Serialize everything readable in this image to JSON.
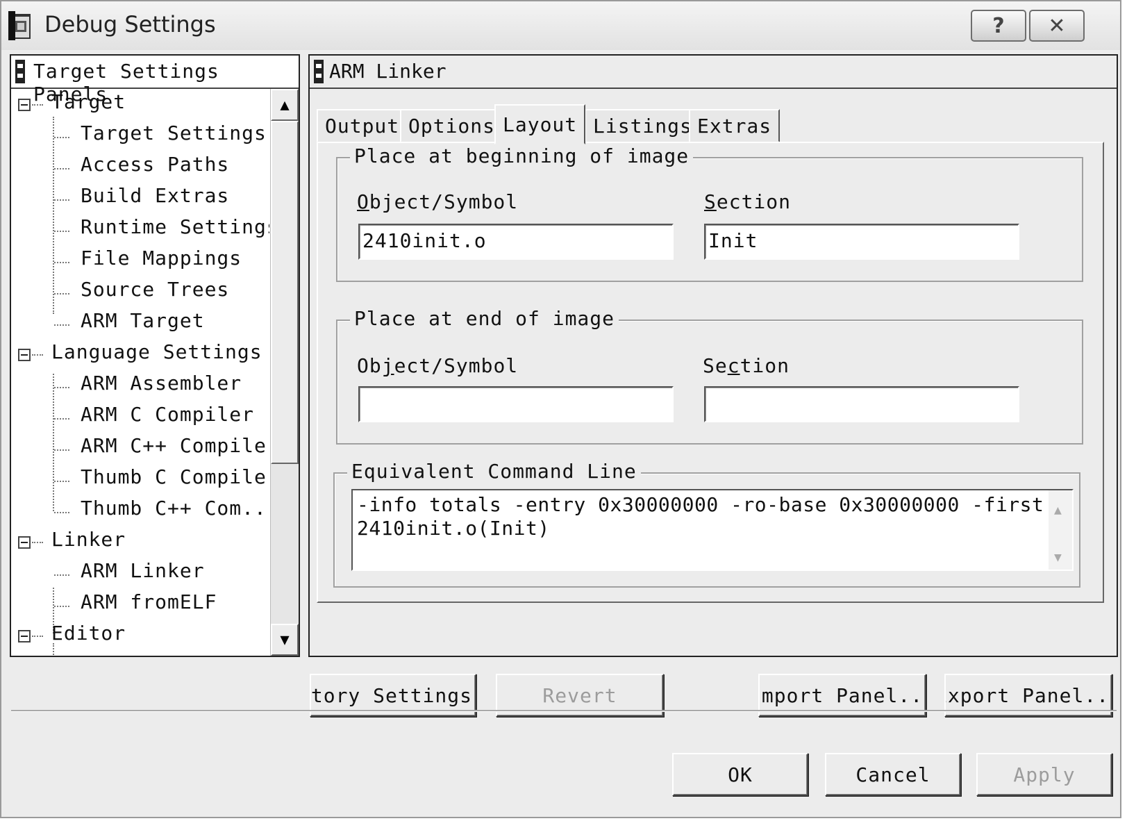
{
  "window": {
    "title": "Debug Settings",
    "help_button": "?",
    "close_button": "✕"
  },
  "left_panel": {
    "header": "Target Settings Panels",
    "tree": [
      {
        "label": "Target",
        "level": 0,
        "expander": true
      },
      {
        "label": "Target Settings",
        "level": 1
      },
      {
        "label": "Access Paths",
        "level": 1
      },
      {
        "label": "Build Extras",
        "level": 1
      },
      {
        "label": "Runtime Settings",
        "level": 1
      },
      {
        "label": "File Mappings",
        "level": 1
      },
      {
        "label": "Source Trees",
        "level": 1
      },
      {
        "label": "ARM Target",
        "level": 1
      },
      {
        "label": "Language Settings",
        "level": 0,
        "expander": true
      },
      {
        "label": "ARM Assembler",
        "level": 1
      },
      {
        "label": "ARM C Compiler",
        "level": 1
      },
      {
        "label": "ARM C++ Compiler",
        "level": 1
      },
      {
        "label": "Thumb C Compiler",
        "level": 1
      },
      {
        "label": "Thumb C++ Com...",
        "level": 1
      },
      {
        "label": "Linker",
        "level": 0,
        "expander": true
      },
      {
        "label": "ARM Linker",
        "level": 1
      },
      {
        "label": "ARM fromELF",
        "level": 1
      },
      {
        "label": "Editor",
        "level": 0,
        "expander": true
      }
    ],
    "scroll_up": "▲",
    "scroll_down": "▼"
  },
  "right_panel": {
    "header": "ARM Linker",
    "tabs": [
      "Output",
      "Options",
      "Layout",
      "Listings",
      "Extras"
    ],
    "active_tab": "Layout",
    "beginning_group": {
      "legend": "Place at beginning of image",
      "object_label_first": "O",
      "object_label_rest": "bject/Symbol",
      "section_label_first": "S",
      "section_label_rest": "ection",
      "object_value": "2410init.o",
      "section_value": "Init"
    },
    "end_group": {
      "legend": "Place at end of image",
      "object_label_pre": "Ob",
      "object_label_u": "j",
      "object_label_post": "ect/Symbol",
      "section_label_pre": "Se",
      "section_label_u": "c",
      "section_label_post": "tion",
      "object_value": "",
      "section_value": ""
    },
    "command_line": {
      "legend": "Equivalent Command Line",
      "line1": "-info totals -entry 0x30000000 -ro-base 0x30000000 -first",
      "line2": "2410init.o(Init)"
    }
  },
  "panel_buttons": {
    "factory": "Factory Settings",
    "revert": "Revert",
    "import": "Import Panel...",
    "export": "Export Panel..."
  },
  "dialog_buttons": {
    "ok": "OK",
    "cancel": "Cancel",
    "apply": "Apply"
  }
}
